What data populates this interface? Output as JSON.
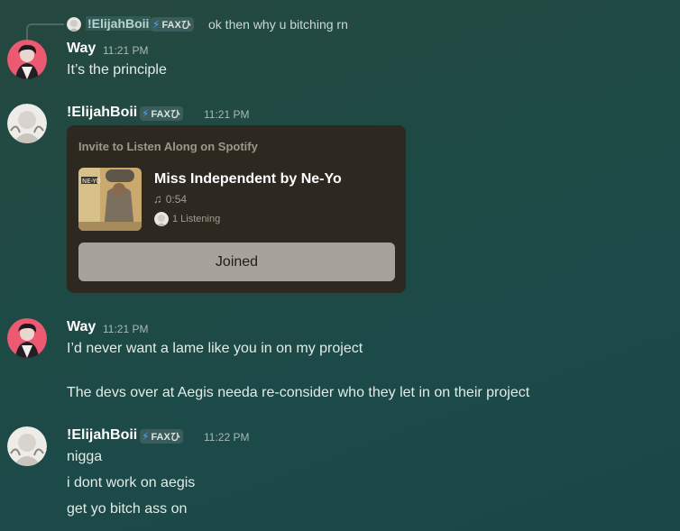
{
  "reply": {
    "username": "!ElijahBoii",
    "tag": "FAXひ",
    "text": "ok then why u bitching rn"
  },
  "messages": [
    {
      "username": "Way",
      "timestamp": "11:21 PM",
      "lines": [
        "It’s the principle"
      ]
    },
    {
      "username": "!ElijahBoii",
      "tag": "FAXひ",
      "timestamp": "11:21 PM",
      "spotify_invite": {
        "heading": "Invite to Listen Along on Spotify",
        "song": "Miss Independent by Ne-Yo",
        "duration": "0:54",
        "listening": "1 Listening",
        "button_label": "Joined"
      }
    },
    {
      "username": "Way",
      "timestamp": "11:21 PM",
      "lines": [
        "I’d never want a lame like you in on my project",
        "The devs over at Aegis needa re-consider who they let in on their project"
      ]
    },
    {
      "username": "!ElijahBoii",
      "tag": "FAXひ",
      "timestamp": "11:22 PM",
      "lines": [
        "nigga",
        "i dont work on aegis",
        "get yo bitch ass on"
      ]
    }
  ],
  "icons": {
    "tag_icon": "lightning-bolt-icon",
    "duration_icon": "music-note-icon"
  },
  "colors": {
    "background": "#1f4a44",
    "card": "#2d2921",
    "joined_button": "#a7a39b",
    "tag_bolt": "#4da3ff"
  }
}
